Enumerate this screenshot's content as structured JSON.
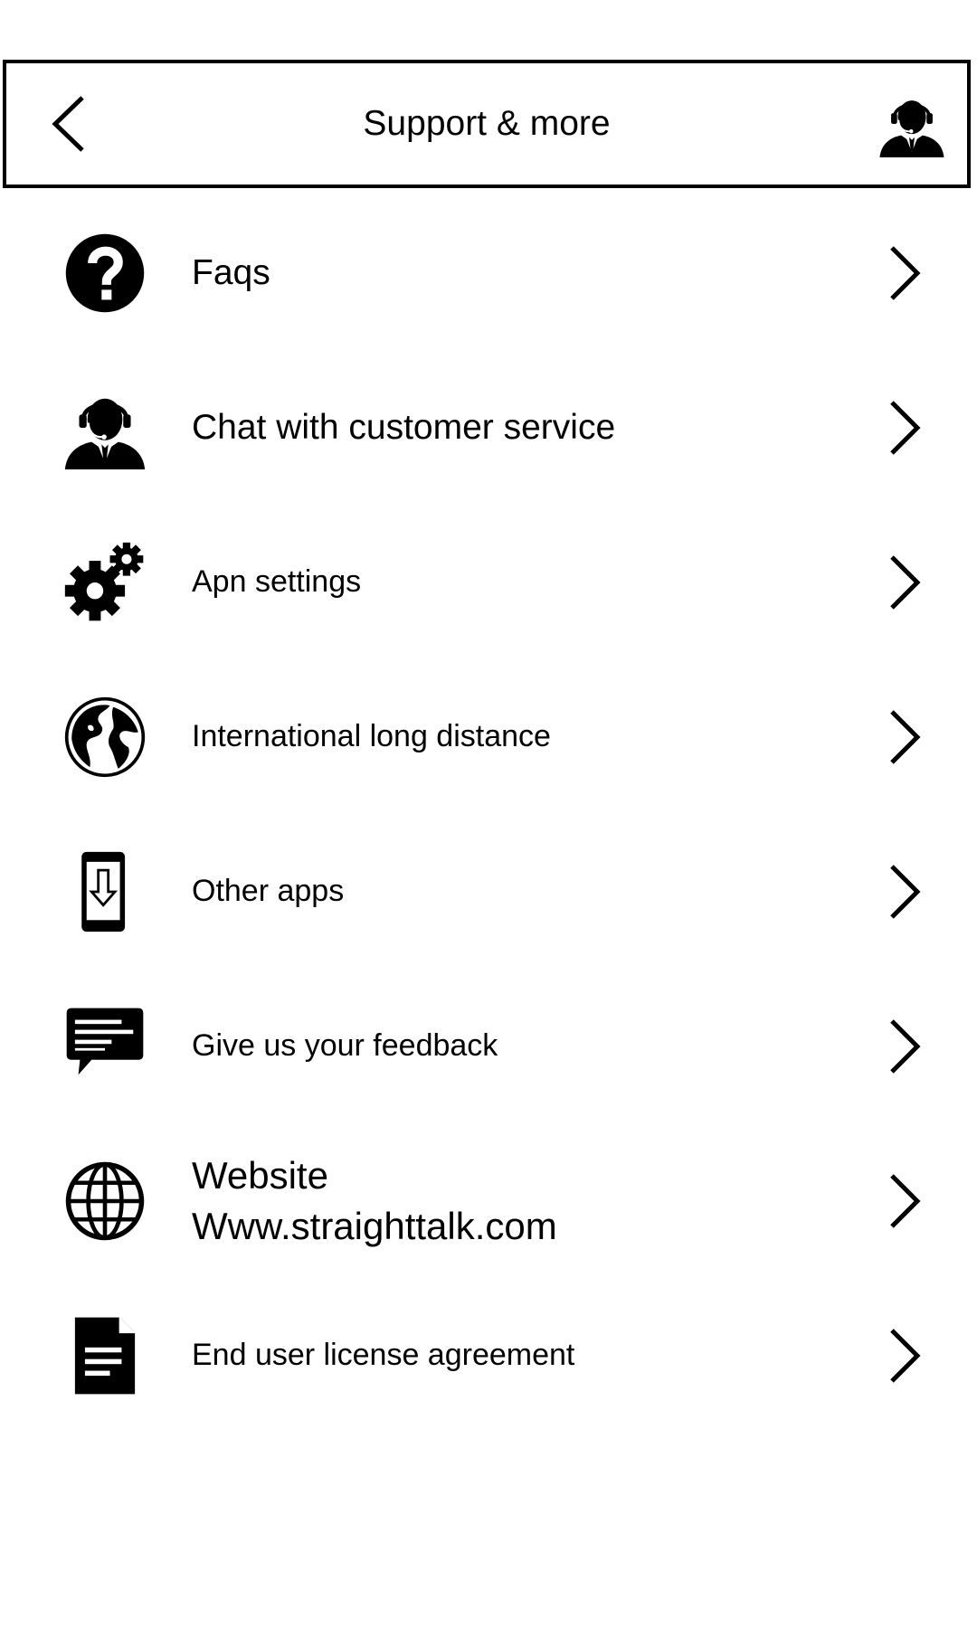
{
  "header": {
    "title": "Support & more",
    "back_icon": "chevron-left-icon",
    "right_icon": "customer-service-agent-icon"
  },
  "menu": {
    "items": [
      {
        "label": "Faqs",
        "icon": "question-circle-icon"
      },
      {
        "label": "Chat with customer service",
        "icon": "customer-service-agent-icon"
      },
      {
        "label": "Apn settings",
        "icon": "gears-icon"
      },
      {
        "label": "International long distance",
        "icon": "globe-earth-icon"
      },
      {
        "label": "Other apps",
        "icon": "phone-download-icon"
      },
      {
        "label": "Give us your feedback",
        "icon": "chat-bubble-icon"
      },
      {
        "label": "Website",
        "sublabel": "Www.straighttalk.com",
        "icon": "globe-grid-icon"
      },
      {
        "label": "End user license agreement",
        "icon": "document-icon"
      }
    ],
    "chevron_icon": "chevron-right-icon"
  },
  "colors": {
    "foreground": "#000000",
    "background": "#ffffff"
  }
}
